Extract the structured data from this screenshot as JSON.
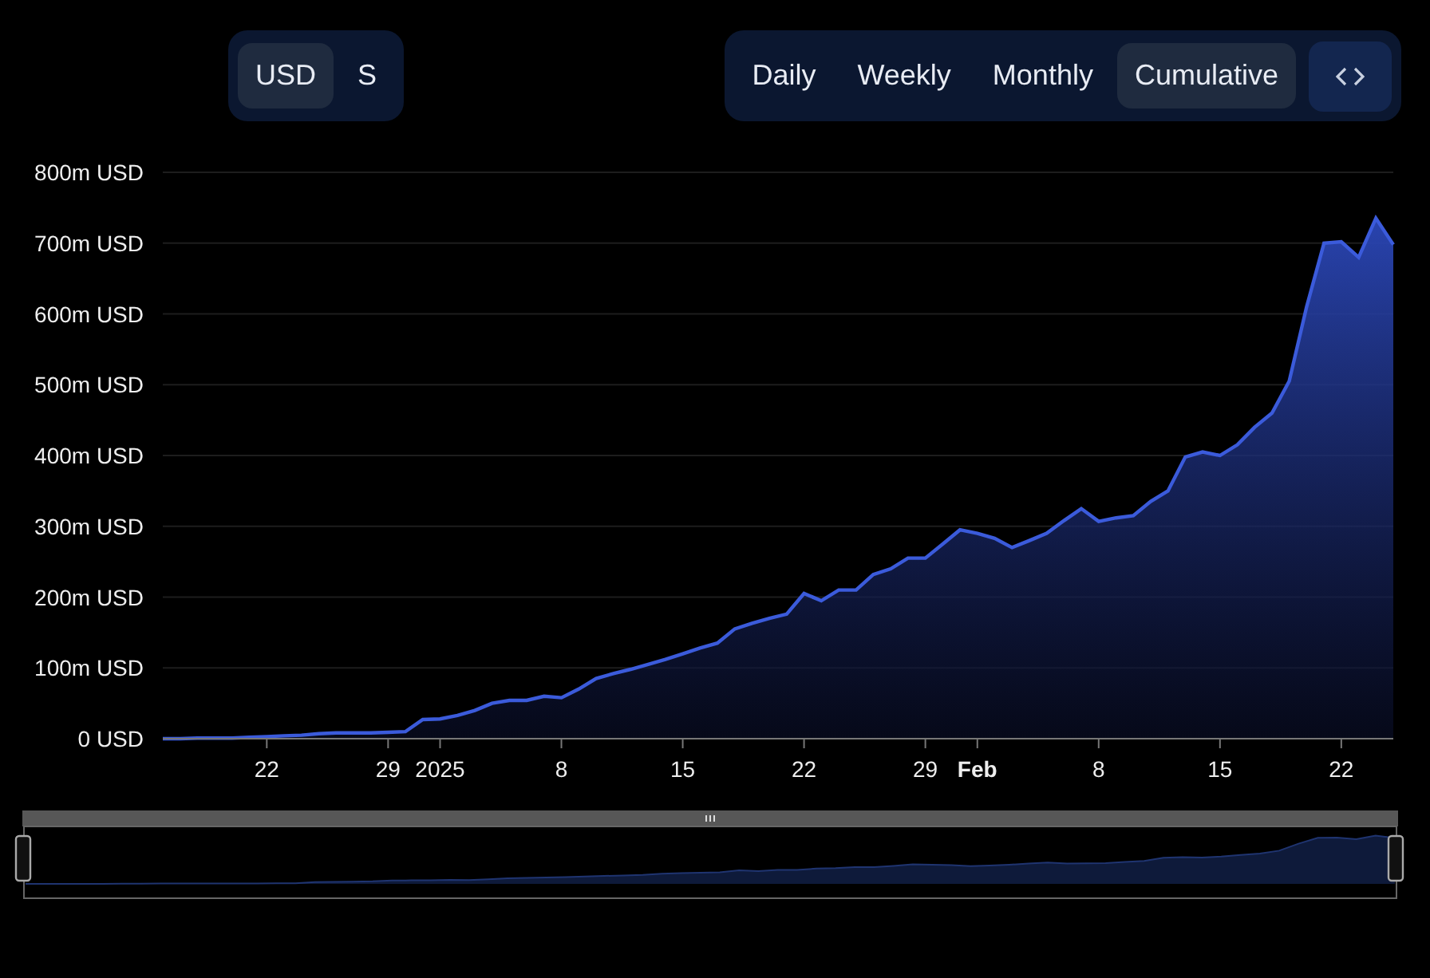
{
  "currency_toggle": [
    {
      "label": "USD",
      "selected": true
    },
    {
      "label": "S",
      "selected": false
    }
  ],
  "period_tabs": [
    {
      "label": "Daily",
      "selected": false
    },
    {
      "label": "Weekly",
      "selected": false
    },
    {
      "label": "Monthly",
      "selected": false
    },
    {
      "label": "Cumulative",
      "selected": true
    }
  ],
  "chart": {
    "chart_data": {
      "type": "area",
      "grid": true,
      "ylim": [
        0,
        800
      ],
      "yticks": [
        {
          "value": 0,
          "label": "0 USD"
        },
        {
          "value": 100,
          "label": "100m USD"
        },
        {
          "value": 200,
          "label": "200m USD"
        },
        {
          "value": 300,
          "label": "300m USD"
        },
        {
          "value": 400,
          "label": "400m USD"
        },
        {
          "value": 500,
          "label": "500m USD"
        },
        {
          "value": 600,
          "label": "600m USD"
        },
        {
          "value": 700,
          "label": "700m USD"
        },
        {
          "value": 800,
          "label": "800m USD"
        }
      ],
      "categories": [
        null,
        null,
        null,
        null,
        null,
        null,
        "22",
        null,
        null,
        null,
        null,
        null,
        null,
        "29",
        null,
        null,
        "2025",
        null,
        null,
        null,
        null,
        null,
        null,
        "8",
        null,
        null,
        null,
        null,
        null,
        null,
        "15",
        null,
        null,
        null,
        null,
        null,
        null,
        "22",
        null,
        null,
        null,
        null,
        null,
        null,
        "29",
        null,
        null,
        "Feb",
        null,
        null,
        null,
        null,
        null,
        null,
        "8",
        null,
        null,
        null,
        null,
        null,
        null,
        "15",
        null,
        null,
        null,
        null,
        null,
        null,
        "22",
        null,
        null,
        null
      ],
      "series": [
        {
          "color": "#3b5bdb",
          "values": [
            0,
            0,
            1,
            1,
            1,
            2,
            3,
            4,
            5,
            7,
            8,
            8,
            8,
            9,
            10,
            27,
            28,
            33,
            40,
            50,
            54,
            54,
            60,
            58,
            70,
            85,
            92,
            98,
            105,
            112,
            120,
            128,
            135,
            155,
            163,
            170,
            176,
            205,
            195,
            210,
            210,
            232,
            240,
            255,
            255,
            275,
            295,
            290,
            283,
            270,
            280,
            290,
            308,
            325,
            307,
            312,
            315,
            335,
            350,
            398,
            405,
            400,
            415,
            440,
            460,
            505,
            610,
            700,
            702,
            680,
            735,
            698
          ]
        }
      ]
    }
  }
}
